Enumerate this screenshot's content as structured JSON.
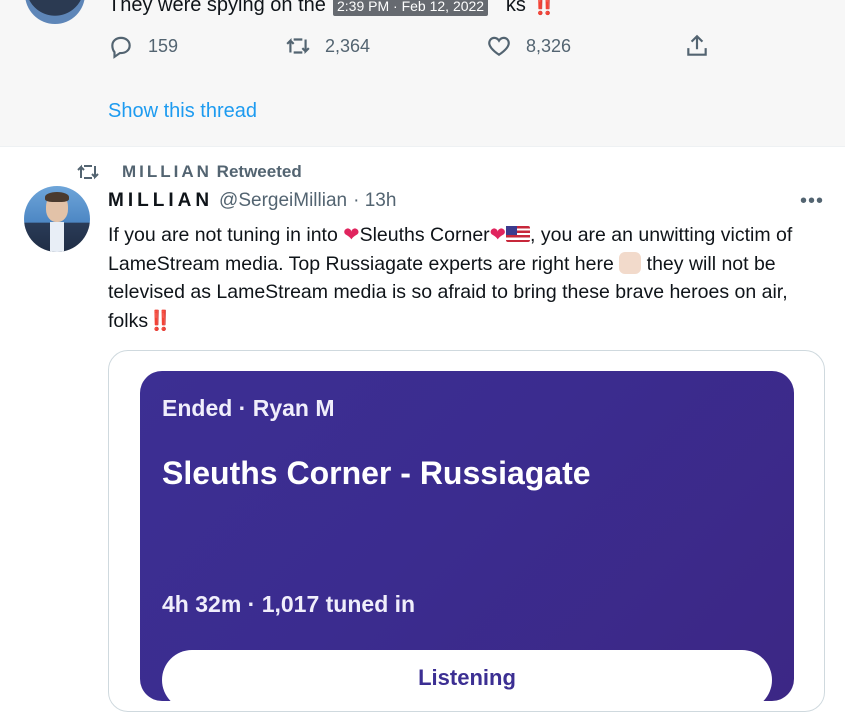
{
  "previous_tweet": {
    "text": "They were spying on the",
    "text_tail": "ks",
    "bangs": "‼️",
    "timestamp_overlay": "2:39 PM · Feb 12, 2022",
    "replies": "159",
    "retweets": "2,364",
    "likes": "8,326",
    "show_thread": "Show this thread"
  },
  "retweet_banner": {
    "name": "MILLIAN",
    "suffix": "Retweeted"
  },
  "tweet": {
    "display_name": "MILLIAN",
    "handle": "@SergeiMillian",
    "time": "· 13h",
    "more": "•••",
    "body_1": "If you are not tuning in into ",
    "body_heart": "❤",
    "body_2": "Sleuths Corner",
    "body_3": ", you are an unwitting victim of LameStream media. Top Russiagate experts are right here ",
    "body_4": " they will not be televised as LameStream media is so afraid to bring these brave heroes on air, folks",
    "body_bangs": "‼️"
  },
  "space_card": {
    "meta": "Ended · Ryan M",
    "title": "Sleuths Corner - Russiagate",
    "stats": "4h 32m  ·  1,017 tuned in",
    "button": "Listening"
  },
  "colors": {
    "accent": "#1d9bf0",
    "muted": "#536471",
    "card_bg": "#3c2f93",
    "heart": "#e0245e"
  }
}
